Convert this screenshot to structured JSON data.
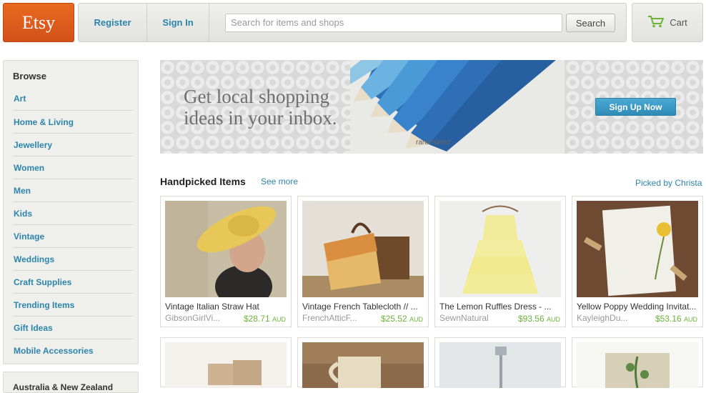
{
  "header": {
    "logo": "Etsy",
    "register_label": "Register",
    "signin_label": "Sign In",
    "search_placeholder": "Search for items and shops",
    "search_button": "Search",
    "cart_label": "Cart"
  },
  "sidebar": {
    "heading": "Browse",
    "items": [
      {
        "label": "Art"
      },
      {
        "label": "Home & Living"
      },
      {
        "label": "Jewellery"
      },
      {
        "label": "Women"
      },
      {
        "label": "Men"
      },
      {
        "label": "Kids"
      },
      {
        "label": "Vintage"
      },
      {
        "label": "Weddings"
      },
      {
        "label": "Craft Supplies"
      },
      {
        "label": "Trending Items"
      },
      {
        "label": "Gift Ideas"
      },
      {
        "label": "Mobile Accessories"
      }
    ],
    "region_label": "Australia & New Zealand"
  },
  "banner": {
    "text_line1": "Get local shopping",
    "text_line2": "ideas in your inbox.",
    "credit": "rareindeed",
    "button": "Sign Up Now"
  },
  "handpicked": {
    "title": "Handpicked Items",
    "see_more": "See more",
    "picked_by": "Picked by Christa",
    "items": [
      {
        "title": "Vintage Italian Straw Hat",
        "shop": "GibsonGirlVi...",
        "price": "$28.71",
        "currency": "AUD"
      },
      {
        "title": "Vintage French Tablecloth // ...",
        "shop": "FrenchAtticF...",
        "price": "$25.52",
        "currency": "AUD"
      },
      {
        "title": "The Lemon Ruffles Dress - ...",
        "shop": "SewnNatural",
        "price": "$93.56",
        "currency": "AUD"
      },
      {
        "title": "Yellow Poppy Wedding Invitat...",
        "shop": "KayleighDu...",
        "price": "$53.16",
        "currency": "AUD"
      }
    ]
  },
  "colors": {
    "brand_orange": "#e1601c",
    "link_blue": "#2b85ad",
    "price_green": "#6bb43a"
  },
  "icons": {
    "cart": "cart-icon"
  }
}
